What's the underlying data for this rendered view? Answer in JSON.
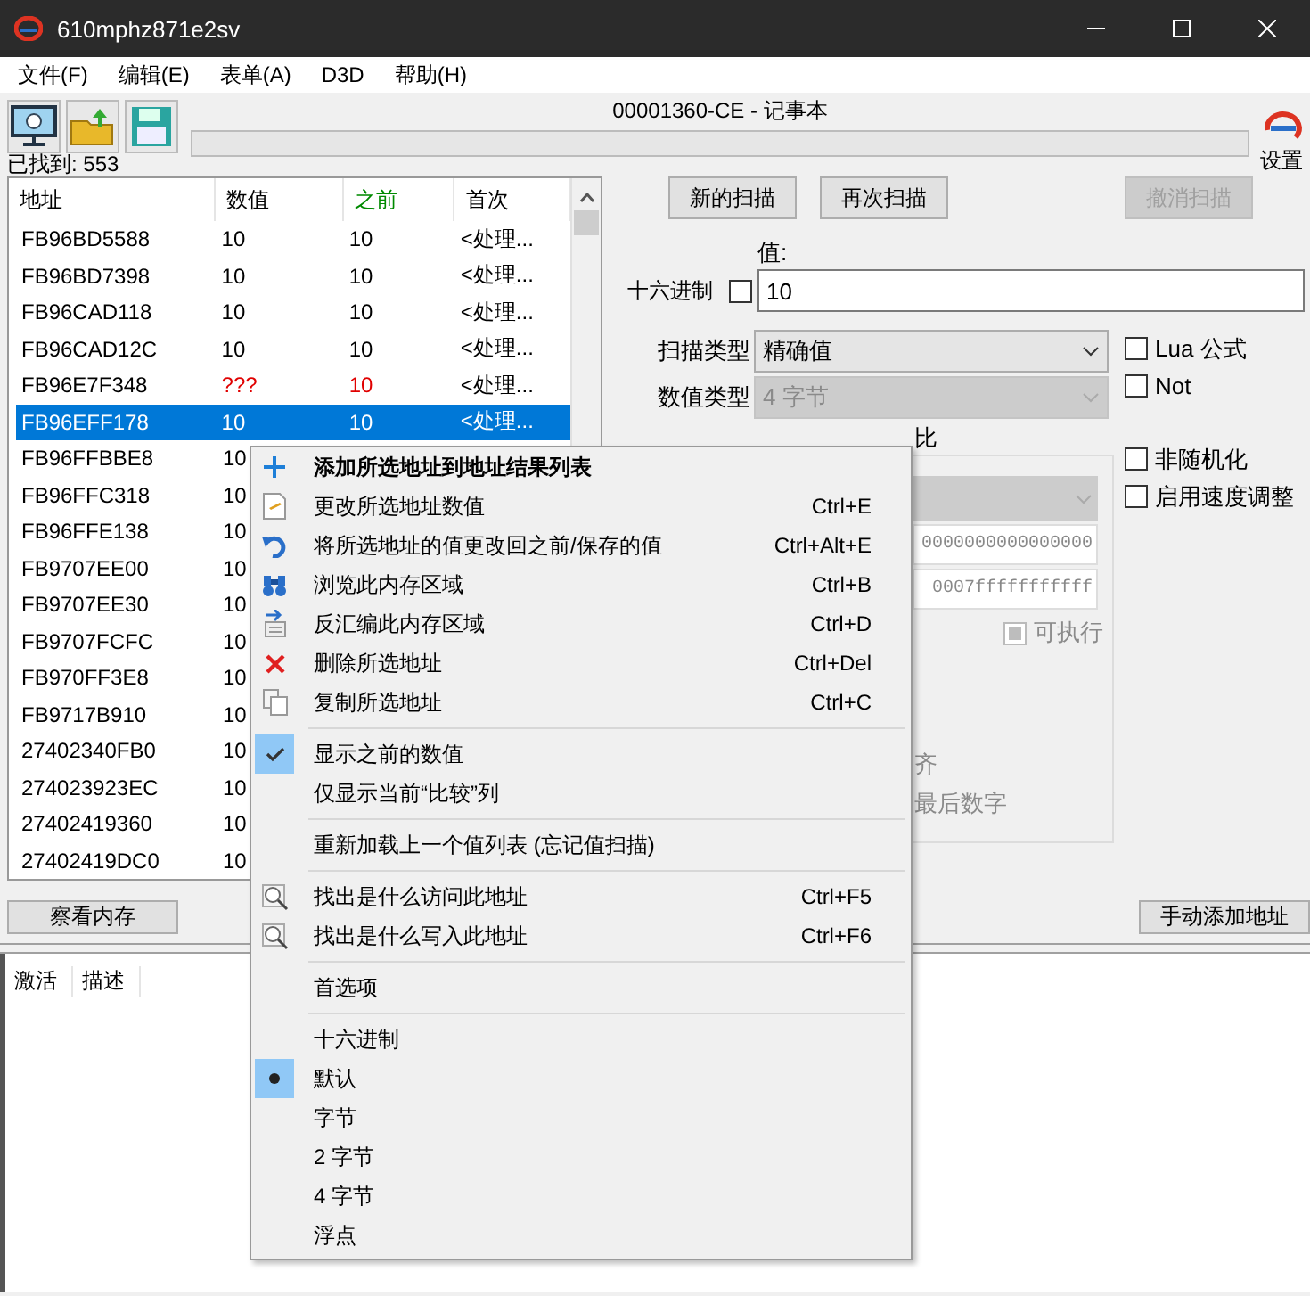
{
  "window": {
    "title": "610mphz871e2sv"
  },
  "menu_bar": [
    "文件(F)",
    "编辑(E)",
    "表单(A)",
    "D3D",
    "帮助(H)"
  ],
  "process_title": "00001360-CE - 记事本",
  "scan_progress": {
    "level": 0
  },
  "settings_label": "设置",
  "found_count": "已找到: 553",
  "results": {
    "columns": [
      {
        "label": "地址",
        "kind": "plain"
      },
      {
        "label": "数值",
        "kind": "plain"
      },
      {
        "label": "之前",
        "kind": "previous"
      },
      {
        "label": "首次",
        "kind": "plain"
      }
    ],
    "rows": [
      {
        "address": "FB96BD5588",
        "value": "10",
        "previous": "10",
        "first": "<处理...",
        "changed": false,
        "selected": false
      },
      {
        "address": "FB96BD7398",
        "value": "10",
        "previous": "10",
        "first": "<处理...",
        "changed": false,
        "selected": false
      },
      {
        "address": "FB96CAD118",
        "value": "10",
        "previous": "10",
        "first": "<处理...",
        "changed": false,
        "selected": false
      },
      {
        "address": "FB96CAD12C",
        "value": "10",
        "previous": "10",
        "first": "<处理...",
        "changed": false,
        "selected": false
      },
      {
        "address": "FB96E7F348",
        "value": "???",
        "previous": "10",
        "first": "<处理...",
        "changed": true,
        "selected": false
      },
      {
        "address": "FB96EFF178",
        "value": "10",
        "previous": "10",
        "first": "<处理...",
        "changed": false,
        "selected": true
      },
      {
        "address": "FB96FFBBE8",
        "value": "10",
        "changed": false,
        "selected": false
      },
      {
        "address": "FB96FFC318",
        "value": "10",
        "changed": false,
        "selected": false
      },
      {
        "address": "FB96FFE138",
        "value": "10",
        "changed": false,
        "selected": false
      },
      {
        "address": "FB9707EE00",
        "value": "10",
        "changed": false,
        "selected": false
      },
      {
        "address": "FB9707EE30",
        "value": "10",
        "changed": false,
        "selected": false
      },
      {
        "address": "FB9707FCFC",
        "value": "10",
        "changed": false,
        "selected": false
      },
      {
        "address": "FB970FF3E8",
        "value": "10",
        "changed": false,
        "selected": false
      },
      {
        "address": "FB9717B910",
        "value": "10",
        "changed": false,
        "selected": false
      },
      {
        "address": "27402340FB0",
        "value": "10",
        "changed": false,
        "selected": false
      },
      {
        "address": "274023923EC",
        "value": "10",
        "changed": false,
        "selected": false
      },
      {
        "address": "27402419360",
        "value": "10",
        "changed": false,
        "selected": false
      },
      {
        "address": "27402419DC0",
        "value": "10",
        "changed": false,
        "selected": false
      }
    ]
  },
  "scan_buttons": [
    {
      "label": "新的扫描",
      "disabled": false
    },
    {
      "label": "再次扫描",
      "disabled": false
    },
    {
      "label": "撤消扫描",
      "disabled": true
    }
  ],
  "value_label": "值:",
  "hex": {
    "label": "十六进制",
    "checked": false
  },
  "value_input": "10",
  "scan_type": {
    "label": "扫描类型",
    "value": "精确值",
    "disabled": false
  },
  "value_type": {
    "label": "数值类型",
    "value": "4 字节",
    "disabled": true
  },
  "compare_fragment": "比",
  "formula_options": [
    {
      "label": "Lua 公式",
      "checked": false
    },
    {
      "label": "Not",
      "checked": false
    }
  ],
  "extra_options": [
    {
      "label": "非随机化",
      "checked": false
    },
    {
      "label": "启用速度调整",
      "checked": false
    }
  ],
  "memory_group": {
    "start": "0000000000000000",
    "stop": "0007fffffffffff",
    "executable": {
      "label": "可执行",
      "disabled": true
    },
    "fragments": [
      "齐",
      "最后数字"
    ]
  },
  "memory_view_button": "察看内存",
  "add_address_button": "手动添加地址",
  "cheat_table": {
    "columns": [
      "激活",
      "描述"
    ]
  },
  "context_menu": [
    {
      "kind": "item",
      "label": "添加所选地址到地址结果列表",
      "bold": true
    },
    {
      "kind": "item",
      "label": "更改所选地址数值",
      "shortcut": "Ctrl+E",
      "bold": false
    },
    {
      "kind": "item",
      "label": "将所选地址的值更改回之前/保存的值",
      "shortcut": "Ctrl+Alt+E",
      "bold": false
    },
    {
      "kind": "item",
      "label": "浏览此内存区域",
      "shortcut": "Ctrl+B",
      "bold": false
    },
    {
      "kind": "item",
      "label": "反汇编此内存区域",
      "shortcut": "Ctrl+D",
      "bold": false
    },
    {
      "kind": "item",
      "label": "删除所选地址",
      "shortcut": "Ctrl+Del",
      "bold": false
    },
    {
      "kind": "item",
      "label": "复制所选地址",
      "shortcut": "Ctrl+C",
      "bold": false
    },
    {
      "kind": "separator"
    },
    {
      "kind": "check",
      "label": "显示之前的数值",
      "checked": true
    },
    {
      "kind": "check",
      "label": "仅显示当前“比较”列",
      "checked": false
    },
    {
      "kind": "separator"
    },
    {
      "kind": "item",
      "label": "重新加载上一个值列表 (忘记值扫描)",
      "bold": false
    },
    {
      "kind": "separator"
    },
    {
      "kind": "item",
      "label": "找出是什么访问此地址",
      "shortcut": "Ctrl+F5",
      "bold": false
    },
    {
      "kind": "item",
      "label": "找出是什么写入此地址",
      "shortcut": "Ctrl+F6",
      "bold": false
    },
    {
      "kind": "separator"
    },
    {
      "kind": "item",
      "label": "首选项",
      "bold": false
    },
    {
      "kind": "separator"
    },
    {
      "kind": "radio",
      "label": "十六进制",
      "selected": false
    },
    {
      "kind": "radio",
      "label": "默认",
      "selected": true
    },
    {
      "kind": "radio",
      "label": "字节",
      "selected": false
    },
    {
      "kind": "radio",
      "label": "2 字节",
      "selected": false
    },
    {
      "kind": "radio",
      "label": "4 字节",
      "selected": false
    },
    {
      "kind": "radio",
      "label": "浮点",
      "selected": false
    }
  ]
}
